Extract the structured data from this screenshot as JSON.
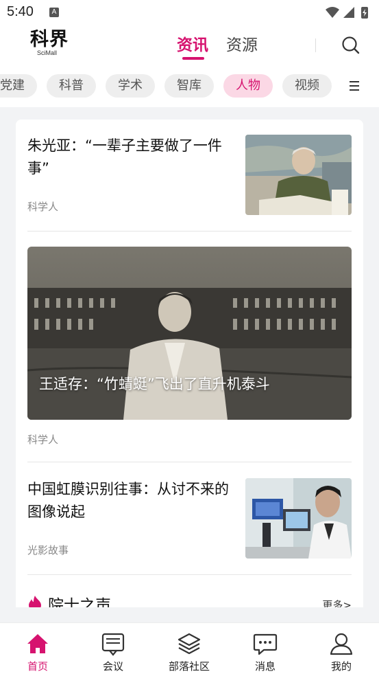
{
  "status_bar": {
    "time": "5:40",
    "notification_icon": "A"
  },
  "header": {
    "logo_main": "科界",
    "logo_sub": "SciMall",
    "tabs": [
      {
        "label": "资讯",
        "active": true
      },
      {
        "label": "资源",
        "active": false
      }
    ],
    "search_icon": "search-icon"
  },
  "categories": [
    {
      "label": "党建",
      "active": false
    },
    {
      "label": "科普",
      "active": false
    },
    {
      "label": "学术",
      "active": false
    },
    {
      "label": "智库",
      "active": false
    },
    {
      "label": "人物",
      "active": true
    },
    {
      "label": "视频",
      "active": false
    }
  ],
  "articles": [
    {
      "title": "朱光亚：“一辈子主要做了一件事”",
      "source": "科学人"
    },
    {
      "title": "王适存：“竹蜻蜓”飞出了直升机泰斗",
      "source": "科学人"
    },
    {
      "title": "中国虹膜识别往事：从讨不来的图像说起",
      "source": "光影故事"
    }
  ],
  "section": {
    "title": "院士之声",
    "more": "更多>"
  },
  "tab_bar": [
    {
      "label": "首页",
      "icon": "home-icon",
      "active": true
    },
    {
      "label": "会议",
      "icon": "meeting-icon",
      "active": false
    },
    {
      "label": "部落社区",
      "icon": "community-icon",
      "active": false
    },
    {
      "label": "消息",
      "icon": "message-icon",
      "active": false
    },
    {
      "label": "我的",
      "icon": "profile-icon",
      "active": false
    }
  ],
  "colors": {
    "accent": "#d6136f",
    "chip_bg": "#eeeeee",
    "chip_active_bg": "#fbd8e5"
  }
}
